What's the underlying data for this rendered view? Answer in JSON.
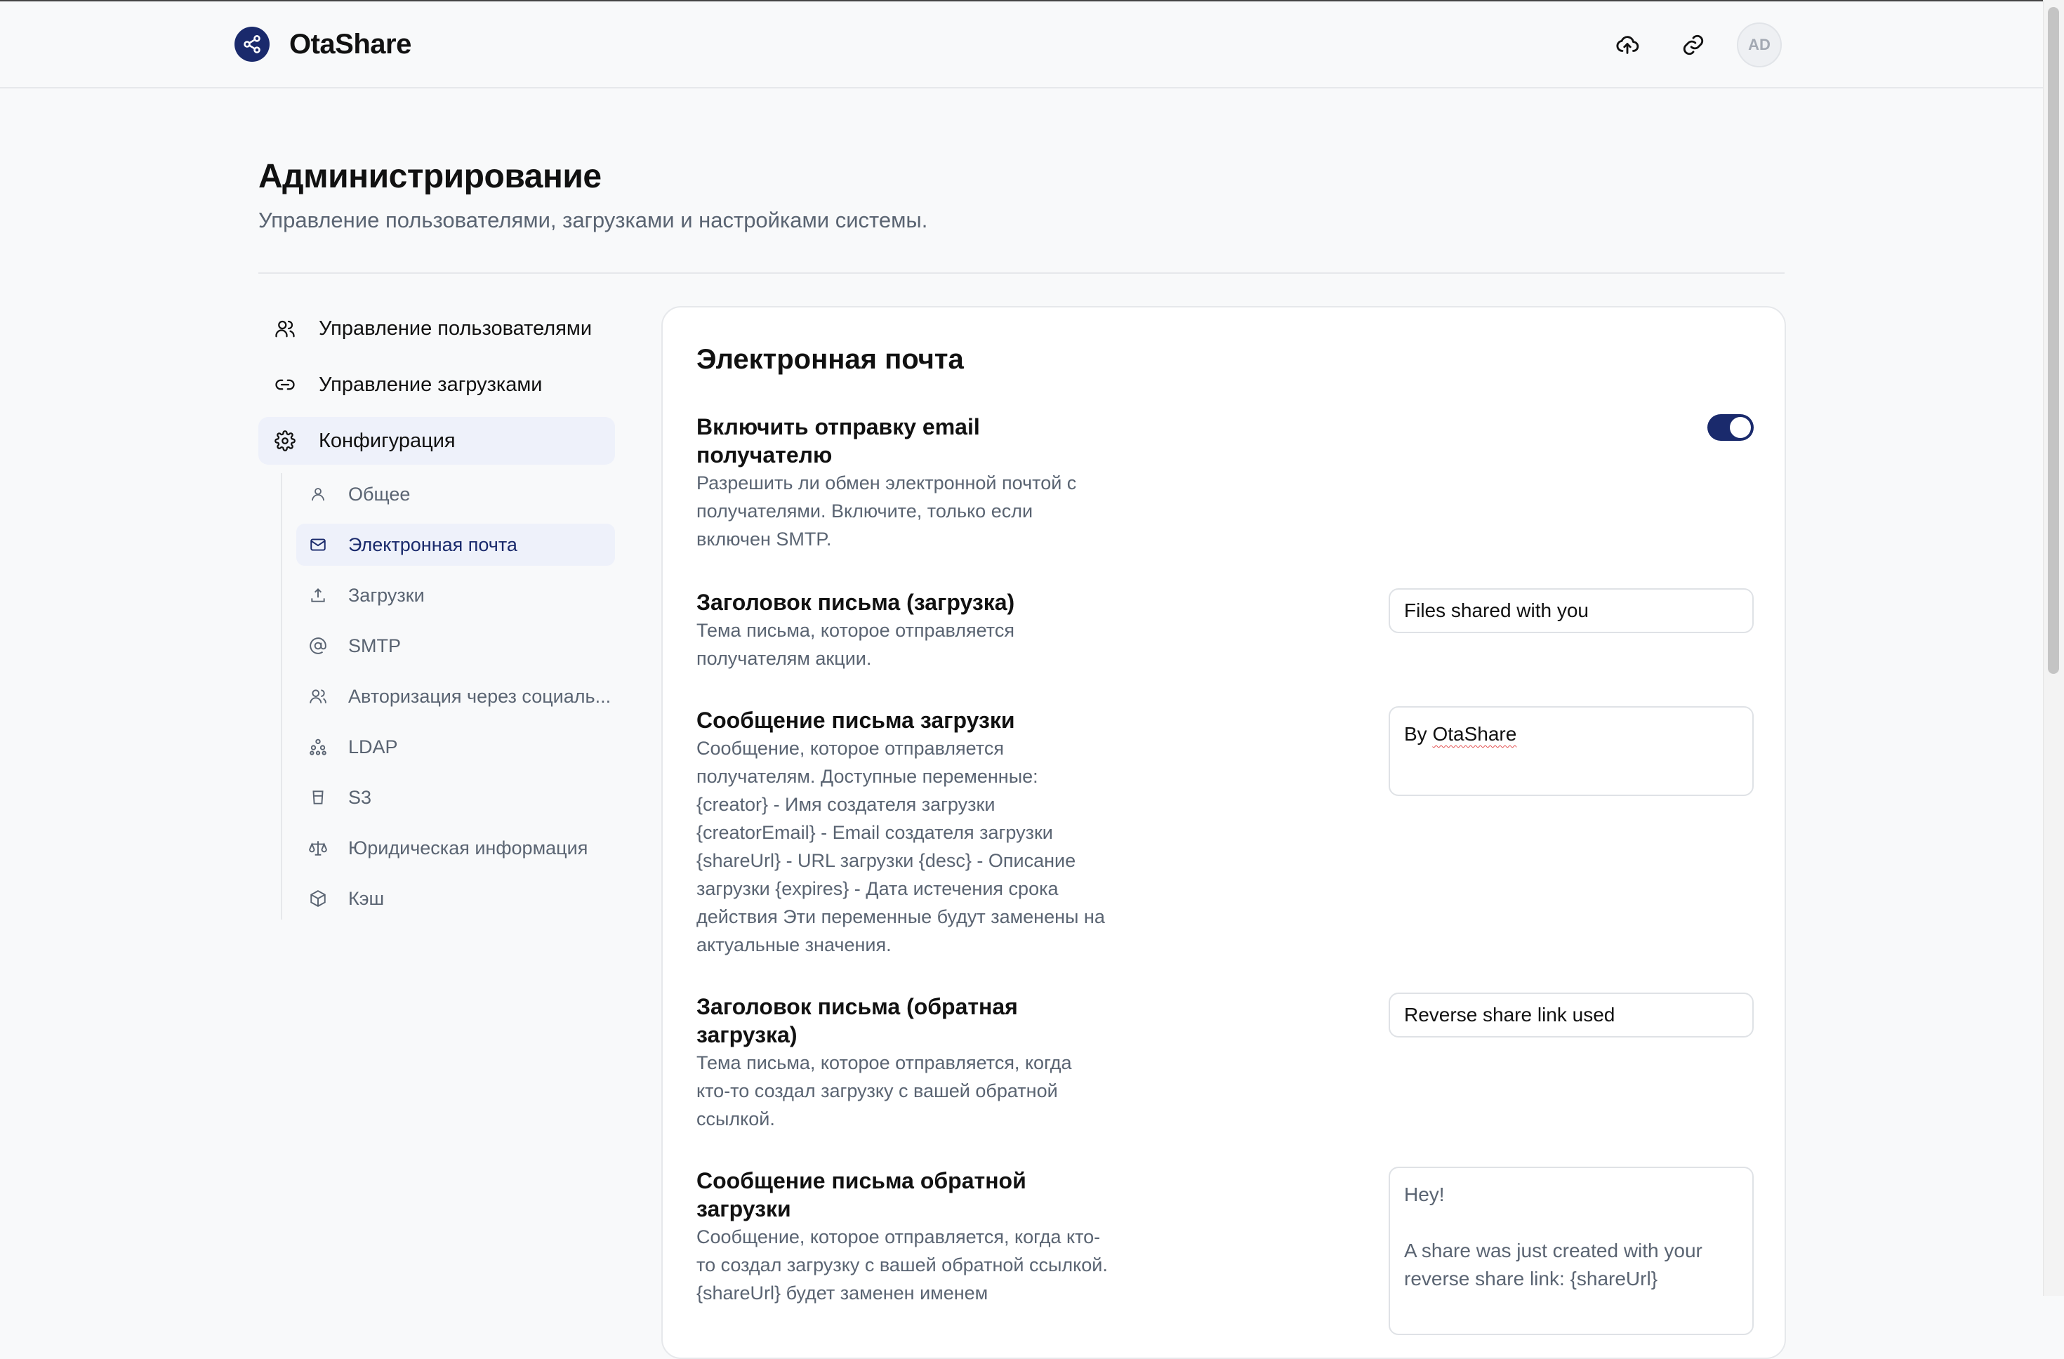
{
  "app": {
    "name": "OtaShare",
    "avatar_initials": "AD"
  },
  "header": {
    "title": "Администрирование",
    "subtitle": "Управление пользователями, загрузками и настройками системы."
  },
  "nav": {
    "items": [
      {
        "label": "Управление пользователями",
        "icon": "users-icon"
      },
      {
        "label": "Управление загрузками",
        "icon": "link-icon"
      },
      {
        "label": "Конфигурация",
        "icon": "gear-icon"
      }
    ],
    "sub_items": [
      {
        "label": "Общее",
        "icon": "user-icon"
      },
      {
        "label": "Электронная почта",
        "icon": "mail-icon"
      },
      {
        "label": "Загрузки",
        "icon": "upload-icon"
      },
      {
        "label": "SMTP",
        "icon": "at-icon"
      },
      {
        "label": "Авторизация через социаль...",
        "icon": "users-icon"
      },
      {
        "label": "LDAP",
        "icon": "network-icon"
      },
      {
        "label": "S3",
        "icon": "bucket-icon"
      },
      {
        "label": "Юридическая информация",
        "icon": "scale-icon"
      },
      {
        "label": "Кэш",
        "icon": "box-icon"
      }
    ]
  },
  "card": {
    "title": "Электронная почта",
    "settings": [
      {
        "title": "Включить отправку email получателю",
        "desc": "Разрешить ли обмен электронной почтой с получателями. Включите, только если включен SMTP.",
        "toggle_on": true
      },
      {
        "title": "Заголовок письма (загрузка)",
        "desc": "Тема письма, которое отправляется получателям акции.",
        "value": "Files shared with you"
      },
      {
        "title": "Сообщение письма загрузки",
        "desc": "Сообщение, которое отправляется получателям. Доступные переменные: {creator} - Имя создателя загрузки {creatorEmail} - Email создателя загрузки {shareUrl} - URL загрузки {desc} - Описание загрузки {expires} - Дата истечения срока действия Эти переменные будут заменены на актуальные значения.",
        "value_prefix": "By ",
        "value_misspelled": "OtaShare"
      },
      {
        "title": "Заголовок письма (обратная загрузка)",
        "desc": "Тема письма, которое отправляется, когда кто-то создал загрузку с вашей обратной ссылкой.",
        "value": "Reverse share link used"
      },
      {
        "title": "Сообщение письма обратной загрузки",
        "desc": "Сообщение, которое отправляется, когда кто-то создал загрузку с вашей обратной ссылкой. {shareUrl} будет заменен именем",
        "value": "Hey!\n\nA share was just created with your reverse share link: {shareUrl}"
      }
    ]
  },
  "colors": {
    "accent": "#1a2a6c",
    "active_bg": "#eef1fa",
    "muted_text": "#5a6472"
  }
}
